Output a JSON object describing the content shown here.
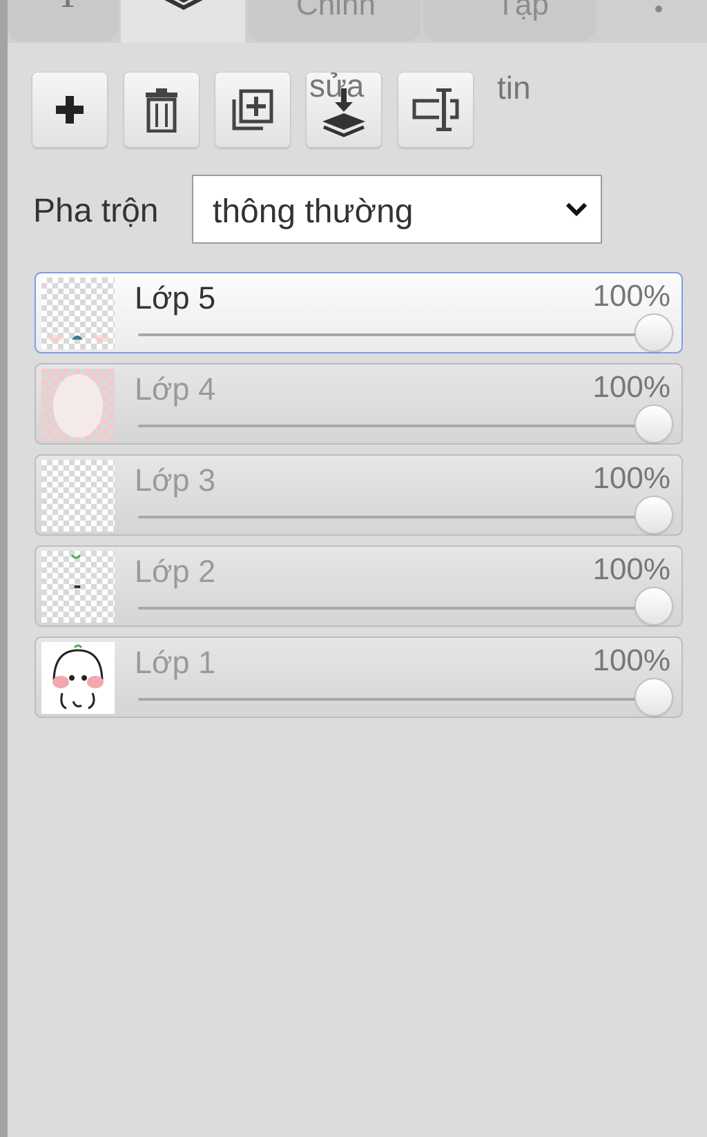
{
  "tabs": [
    {
      "label": "",
      "icon": "text-tool-icon"
    },
    {
      "label": "",
      "icon": "layers-icon"
    },
    {
      "label": "Chỉnh"
    },
    {
      "label": "Tập"
    },
    {
      "label": "",
      "icon": "more-vertical-icon"
    }
  ],
  "toolbar": {
    "add": "add-layer-icon",
    "delete": "trash-icon",
    "duplicate": "duplicate-layer-icon",
    "merge_label": "sửa",
    "rename": "rename-icon",
    "info_label": "tin"
  },
  "blend": {
    "label": "Pha trộn",
    "value": "thông thường"
  },
  "layers": [
    {
      "name": "Lớp 5",
      "opacity": "100%",
      "opacity_value": 1.0,
      "active": true
    },
    {
      "name": "Lớp 4",
      "opacity": "100%",
      "opacity_value": 1.0,
      "active": false
    },
    {
      "name": "Lớp 3",
      "opacity": "100%",
      "opacity_value": 1.0,
      "active": false
    },
    {
      "name": "Lớp 2",
      "opacity": "100%",
      "opacity_value": 1.0,
      "active": false
    },
    {
      "name": "Lớp 1",
      "opacity": "100%",
      "opacity_value": 1.0,
      "active": false
    }
  ],
  "colors": {
    "active_border": "#7e9fe6",
    "panel_bg": "#dcdcdc",
    "thumb_pink": "#f6c8cc"
  }
}
